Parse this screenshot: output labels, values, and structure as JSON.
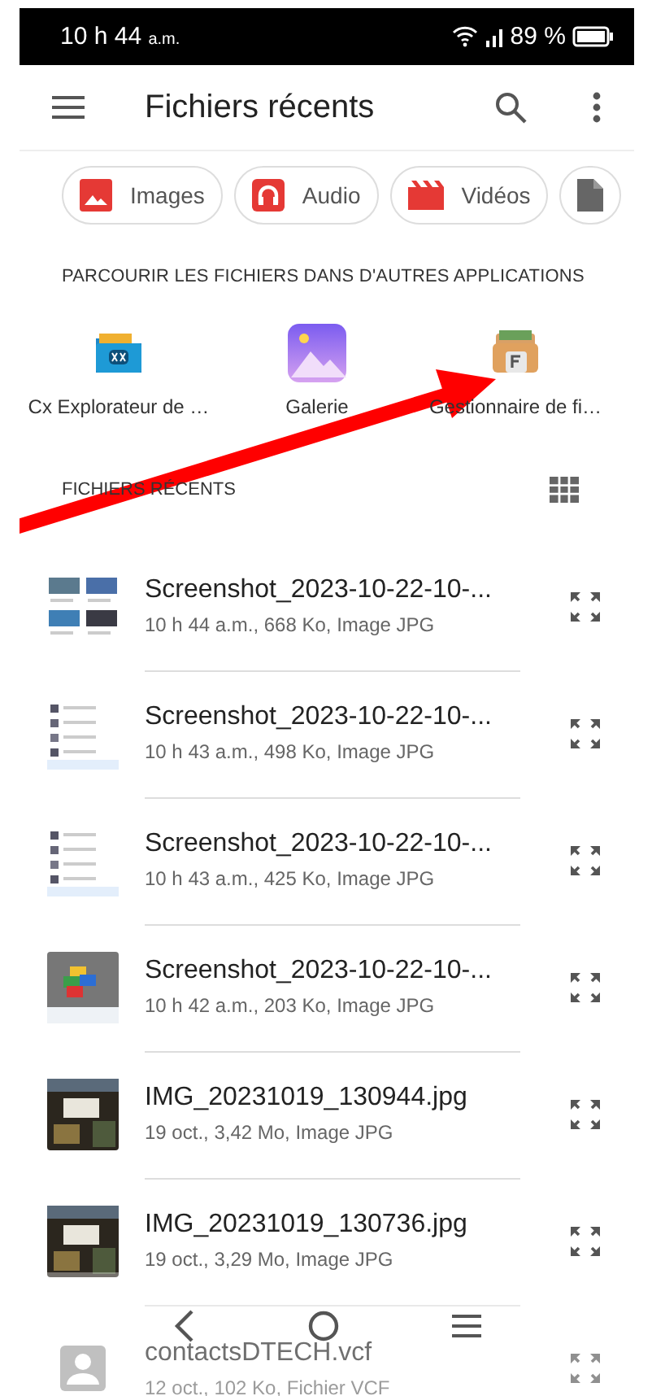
{
  "status_bar": {
    "time": "10 h 44",
    "time_suffix": "a.m.",
    "battery": "89 %"
  },
  "app_bar": {
    "title": "Fichiers récents"
  },
  "chips": [
    {
      "label": "Images",
      "kind": "images"
    },
    {
      "label": "Audio",
      "kind": "audio"
    },
    {
      "label": "Vidéos",
      "kind": "videos"
    },
    {
      "kind": "documents"
    }
  ],
  "apps_section": {
    "title": "PARCOURIR LES FICHIERS DANS D'AUTRES APPLICATIONS",
    "apps": [
      {
        "label": "Cx Explorateur de …",
        "kind": "cx"
      },
      {
        "label": "Galerie",
        "kind": "gallery"
      },
      {
        "label": "Gestionnaire de fi…",
        "kind": "manager"
      }
    ]
  },
  "recent": {
    "title": "FICHIERS RÉCENTS",
    "files": [
      {
        "name": "Screenshot_2023-10-22-10-...",
        "details": "10 h 44 a.m., 668 Ko, Image JPG",
        "kind": "grid"
      },
      {
        "name": "Screenshot_2023-10-22-10-...",
        "details": "10 h 43 a.m., 498 Ko, Image JPG",
        "kind": "list"
      },
      {
        "name": "Screenshot_2023-10-22-10-...",
        "details": "10 h 43 a.m., 425 Ko, Image JPG",
        "kind": "list"
      },
      {
        "name": "Screenshot_2023-10-22-10-...",
        "details": "10 h 42 a.m., 203 Ko, Image JPG",
        "kind": "bricks"
      },
      {
        "name": "IMG_20231019_130944.jpg",
        "details": "19 oct., 3,42 Mo, Image JPG"
      },
      {
        "name": "IMG_20231019_130736.jpg",
        "details": "19 oct., 3,29 Mo, Image JPG"
      },
      {
        "name": "contactsDTECH.vcf",
        "details": "12 oct., 102 Ko, Fichier VCF",
        "kind": "contact"
      }
    ]
  }
}
